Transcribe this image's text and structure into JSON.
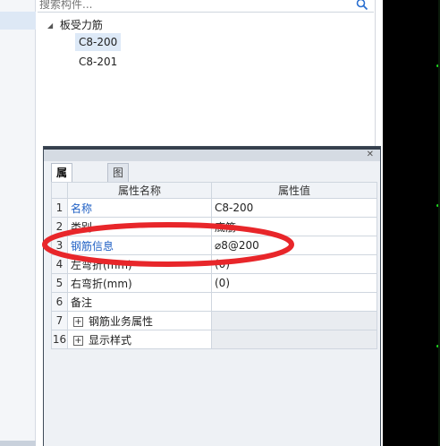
{
  "search": {
    "placeholder": "搜索构件..."
  },
  "tree": {
    "root_label": "板受力筋",
    "children": [
      {
        "label": "C8-200"
      },
      {
        "label": "C8-201"
      }
    ]
  },
  "panel": {
    "tabs": [
      {
        "label": "属性列表",
        "active": true
      },
      {
        "label": "图层管理",
        "active": false
      }
    ],
    "columns": {
      "name": "属性名称",
      "value": "属性值"
    },
    "rows": [
      {
        "num": "1",
        "name": "名称",
        "value": "C8-200"
      },
      {
        "num": "2",
        "name": "类别",
        "value": "底筋"
      },
      {
        "num": "3",
        "name": "钢筋信息",
        "value": "⌀8@200"
      },
      {
        "num": "4",
        "name": "左弯折(mm)",
        "value": "(0)"
      },
      {
        "num": "5",
        "name": "右弯折(mm)",
        "value": "(0)"
      },
      {
        "num": "6",
        "name": "备注",
        "value": ""
      },
      {
        "num": "7",
        "name": "钢筋业务属性",
        "value": ""
      },
      {
        "num": "16",
        "name": "显示样式",
        "value": ""
      }
    ]
  },
  "colors": {
    "link_blue": "#1e5fc4",
    "annotation_red": "#e8262a",
    "selection_bg": "#dde9f7",
    "dark_pane": "#000000"
  }
}
